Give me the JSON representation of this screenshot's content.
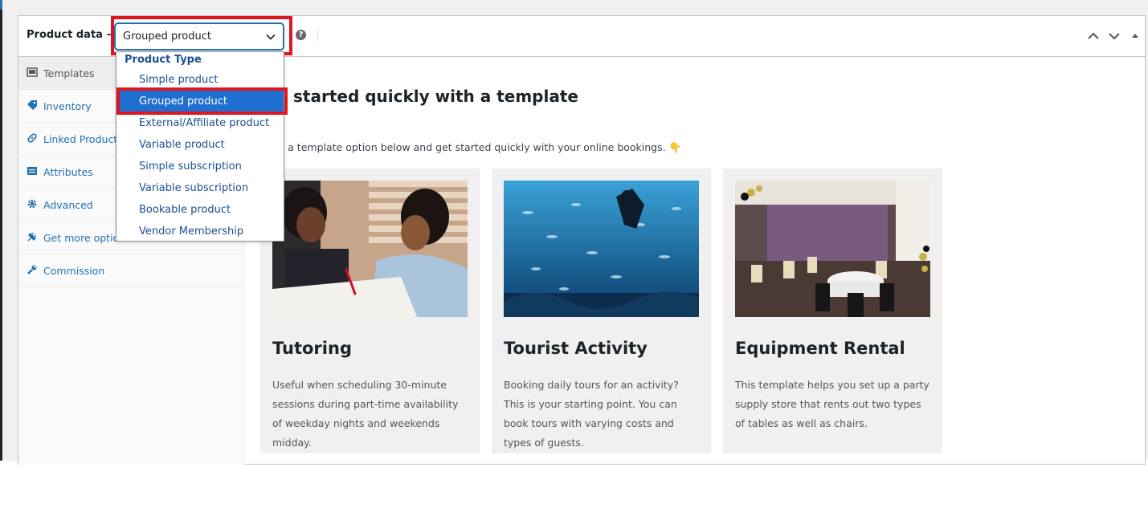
{
  "header": {
    "title": "Product data —",
    "selected_type": "Grouped product",
    "help_glyph": "?"
  },
  "tabs": [
    {
      "label": "Templates",
      "icon": "template-icon",
      "active": true
    },
    {
      "label": "Inventory",
      "icon": "tag-icon"
    },
    {
      "label": "Linked Products",
      "icon": "link-icon"
    },
    {
      "label": "Attributes",
      "icon": "list-icon"
    },
    {
      "label": "Advanced",
      "icon": "gear-icon"
    },
    {
      "label": "Get more options",
      "icon": "plugin-icon"
    },
    {
      "label": "Commission",
      "icon": "wrench-icon"
    }
  ],
  "dropdown": {
    "group_label": "Product Type",
    "options": [
      "Simple product",
      "Grouped product",
      "External/Affiliate product",
      "Variable product",
      "Simple subscription",
      "Variable subscription",
      "Bookable product",
      "Vendor Membership"
    ],
    "selected": "Grouped product"
  },
  "main": {
    "heading": "started quickly with a template",
    "description": "se a template option below and get started quickly with your online bookings. 👇"
  },
  "cards": [
    {
      "title": "Tutoring",
      "description": "Useful when scheduling 30-minute sessions during part-time availability of weekday nights and weekends midday."
    },
    {
      "title": "Tourist Activity",
      "description": "Booking daily tours for an activity? This is your starting point. You can book tours with varying costs and types of guests."
    },
    {
      "title": "Equipment Rental",
      "description": "This template helps you set up a party supply store that rents out two types of tables as well as chairs."
    }
  ],
  "colors": {
    "accent": "#2271b1",
    "highlight": "#e0161e",
    "selected_option": "#1f6fd1"
  }
}
